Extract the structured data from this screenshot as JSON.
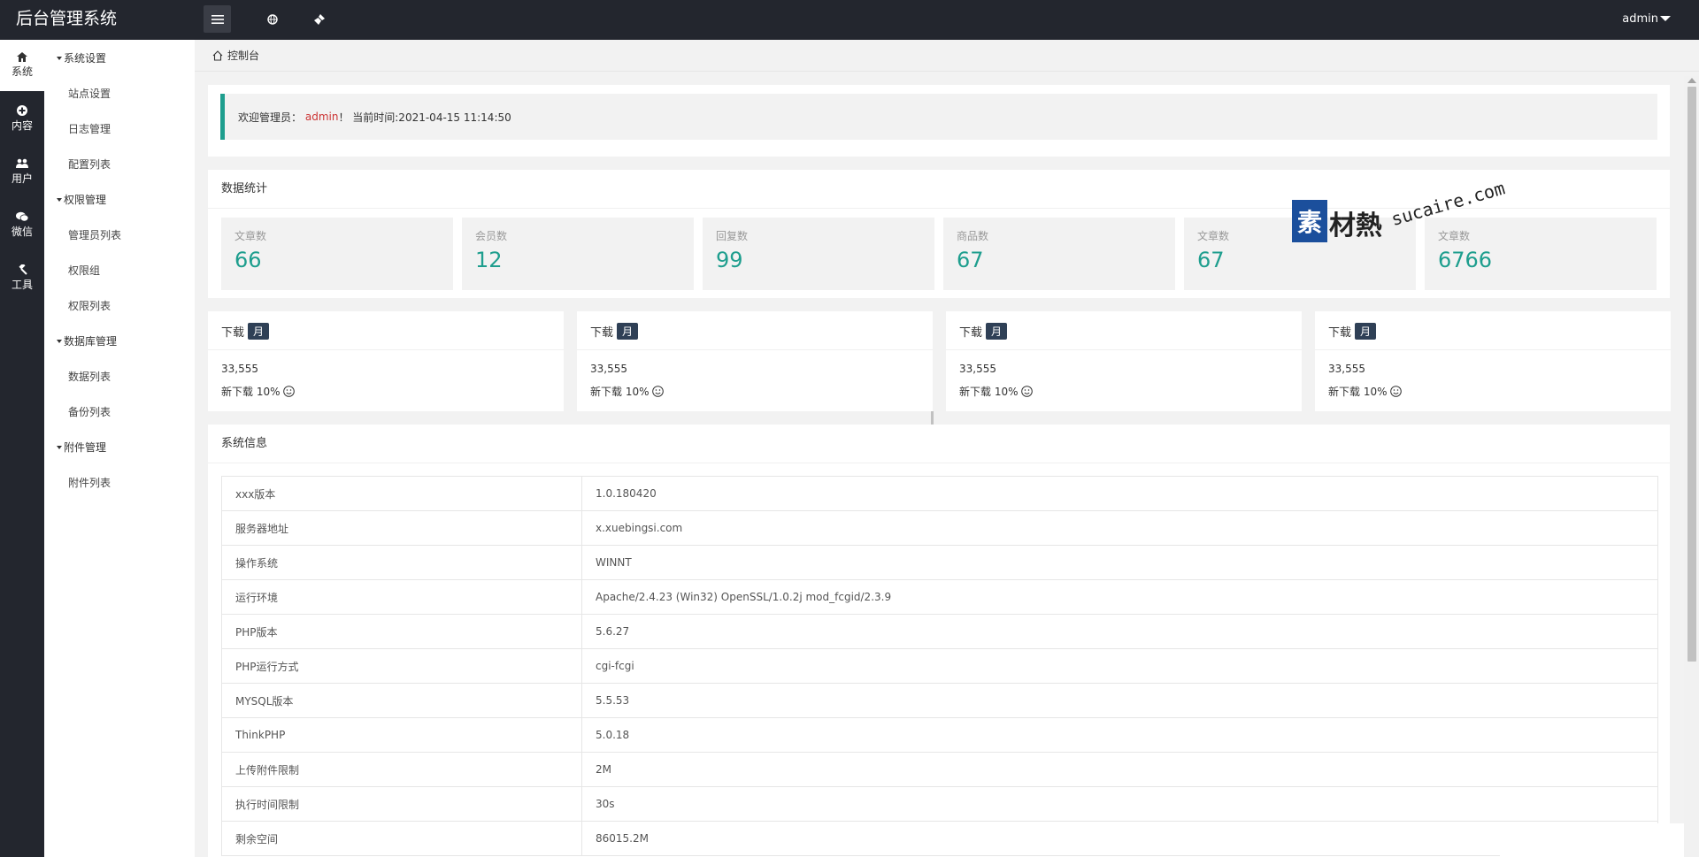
{
  "app": {
    "title": "后台管理系统"
  },
  "topbar": {
    "user": "admin"
  },
  "rail": [
    {
      "label": "系统",
      "icon": "home-icon"
    },
    {
      "label": "内容",
      "icon": "plus-circle-icon"
    },
    {
      "label": "用户",
      "icon": "users-icon"
    },
    {
      "label": "微信",
      "icon": "wechat-icon"
    },
    {
      "label": "工具",
      "icon": "gavel-icon"
    }
  ],
  "sidebar": {
    "groups": [
      {
        "label": "系统设置",
        "items": [
          "站点设置",
          "日志管理",
          "配置列表"
        ]
      },
      {
        "label": "权限管理",
        "items": [
          "管理员列表",
          "权限组",
          "权限列表"
        ]
      },
      {
        "label": "数据库管理",
        "items": [
          "数据列表",
          "备份列表"
        ]
      },
      {
        "label": "附件管理",
        "items": [
          "附件列表"
        ]
      }
    ]
  },
  "breadcrumb": {
    "label": "控制台"
  },
  "welcome": {
    "prefix": "欢迎管理员：",
    "user": "admin",
    "suffix": "！ 当前时间:2021-04-15 11:14:50"
  },
  "stats": {
    "title": "数据统计",
    "items": [
      {
        "label": "文章数",
        "value": "66"
      },
      {
        "label": "会员数",
        "value": "12"
      },
      {
        "label": "回复数",
        "value": "99"
      },
      {
        "label": "商品数",
        "value": "67"
      },
      {
        "label": "文章数",
        "value": "67"
      },
      {
        "label": "文章数",
        "value": "6766"
      }
    ]
  },
  "downloads": [
    {
      "title": "下载",
      "badge": "月",
      "count": "33,555",
      "sub": "新下载 10%"
    },
    {
      "title": "下载",
      "badge": "月",
      "count": "33,555",
      "sub": "新下载 10%"
    },
    {
      "title": "下载",
      "badge": "月",
      "count": "33,555",
      "sub": "新下载 10%"
    },
    {
      "title": "下载",
      "badge": "月",
      "count": "33,555",
      "sub": "新下载 10%"
    }
  ],
  "sysinfo": {
    "title": "系统信息",
    "rows": [
      {
        "key": "xxx版本",
        "value": "1.0.180420"
      },
      {
        "key": "服务器地址",
        "value": "x.xuebingsi.com"
      },
      {
        "key": "操作系统",
        "value": "WINNT"
      },
      {
        "key": "运行环境",
        "value": "Apache/2.4.23 (Win32) OpenSSL/1.0.2j mod_fcgid/2.3.9"
      },
      {
        "key": "PHP版本",
        "value": "5.6.27"
      },
      {
        "key": "PHP运行方式",
        "value": "cgi-fcgi"
      },
      {
        "key": "MYSQL版本",
        "value": "5.5.53"
      },
      {
        "key": "ThinkPHP",
        "value": "5.0.18"
      },
      {
        "key": "上传附件限制",
        "value": "2M"
      },
      {
        "key": "执行时间限制",
        "value": "30s"
      },
      {
        "key": "剩余空间",
        "value": "86015.2M"
      }
    ]
  },
  "watermark": {
    "badge": "素",
    "cn": "材熱",
    "en": "sucaire.com"
  },
  "colors": {
    "accent": "#1e9e8e",
    "topbar": "#23262e",
    "badge": "#2f4056",
    "admin_text": "#cc3333"
  }
}
